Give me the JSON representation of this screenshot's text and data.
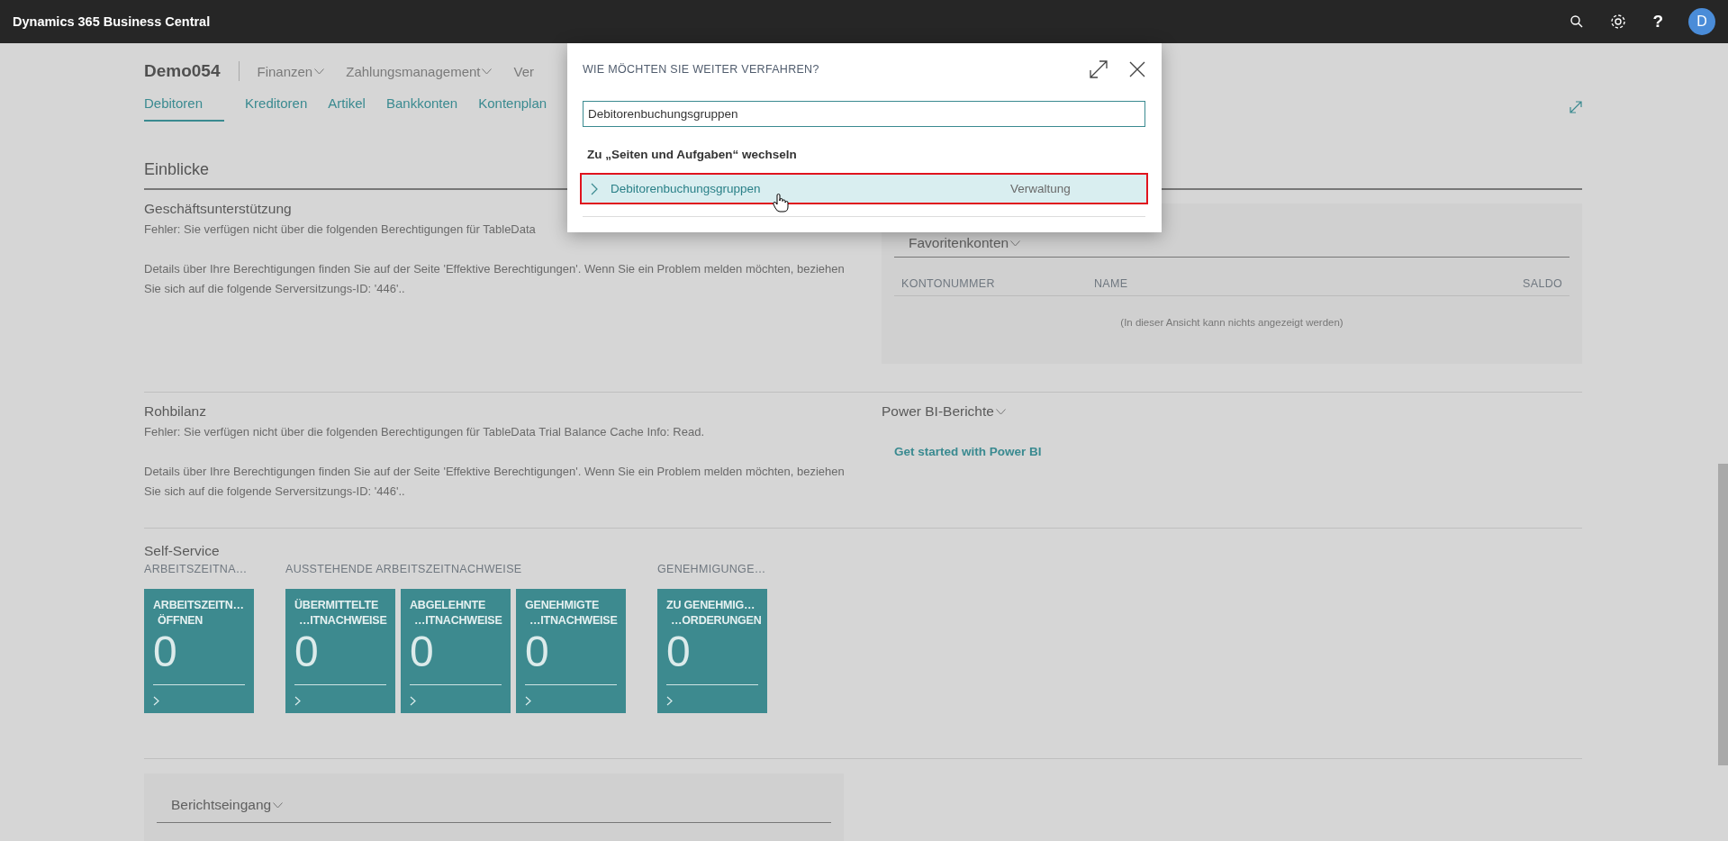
{
  "app_bar": {
    "title": "Dynamics 365 Business Central",
    "help": "?",
    "avatar": "D"
  },
  "company": "Demo054",
  "menu": [
    {
      "label": "Finanzen",
      "has_menu": true
    },
    {
      "label": "Zahlungsmanagement",
      "has_menu": true
    },
    {
      "label": "Ver",
      "has_menu": false
    }
  ],
  "tabs": [
    {
      "label": "Debitoren",
      "selected": true
    },
    {
      "label": "Kreditoren",
      "selected": false
    },
    {
      "label": "Artikel",
      "selected": false
    },
    {
      "label": "Bankkonten",
      "selected": false
    },
    {
      "label": "Kontenplan",
      "selected": false
    }
  ],
  "insights": {
    "title": "Einblicke",
    "business_support": {
      "title": "Geschäftsunterstützung",
      "error": "Fehler: Sie verfügen nicht über die folgenden Berechtigungen für TableData",
      "details": "Details über Ihre Berechtigungen finden Sie auf der Seite 'Effektive Berechtigungen'. Wenn Sie ein Problem melden möchten, beziehen Sie sich auf die folgende Serversitzungs-ID: '446'.."
    },
    "favorites": {
      "title": "Favoritenkonten",
      "columns": [
        "KONTONUMMER",
        "NAME",
        "SALDO"
      ],
      "empty": "(In dieser Ansicht kann nichts angezeigt werden)"
    },
    "trial_balance": {
      "title": "Rohbilanz",
      "error": "Fehler: Sie verfügen nicht über die folgenden Berechtigungen für TableData Trial Balance Cache Info: Read.",
      "details": "Details über Ihre Berechtigungen finden Sie auf der Seite 'Effektive Berechtigungen'. Wenn Sie ein Problem melden möchten, beziehen Sie sich auf die folgende Serversitzungs-ID: '446'.."
    },
    "power_bi": {
      "title": "Power BI-Berichte",
      "link": "Get started with Power BI"
    }
  },
  "self_service": {
    "title": "Self-Service",
    "groups": [
      {
        "title": "ARBEITSZEITNA…",
        "tiles": [
          {
            "label_lines": [
              "ARBEITSZEITN…",
              "ÖFFNEN"
            ],
            "value": "0"
          }
        ]
      },
      {
        "title": "AUSSTEHENDE ARBEITSZEITNACHWEISE",
        "tiles": [
          {
            "label_lines": [
              "ÜBERMITTELTE",
              "…ITNACHWEISE"
            ],
            "value": "0"
          },
          {
            "label_lines": [
              "ABGELEHNTE",
              "…ITNACHWEISE"
            ],
            "value": "0"
          },
          {
            "label_lines": [
              "GENEHMIGTE",
              "…ITNACHWEISE"
            ],
            "value": "0"
          }
        ]
      },
      {
        "title": "GENEHMIGUNGE…",
        "tiles": [
          {
            "label_lines": [
              "ZU GENEHMIG…",
              "…ORDERUNGEN"
            ],
            "value": "0"
          }
        ]
      }
    ]
  },
  "report_inbox": {
    "title": "Berichtseingang"
  },
  "dialog": {
    "title": "WIE MÖCHTEN SIE WEITER VERFAHREN?",
    "search_value": "Debitorenbuchungsgruppen",
    "section": "Zu „Seiten und Aufgaben“ wechseln",
    "results": [
      {
        "name": "Debitorenbuchungsgruppen",
        "category": "Verwaltung",
        "selected": true
      }
    ]
  }
}
